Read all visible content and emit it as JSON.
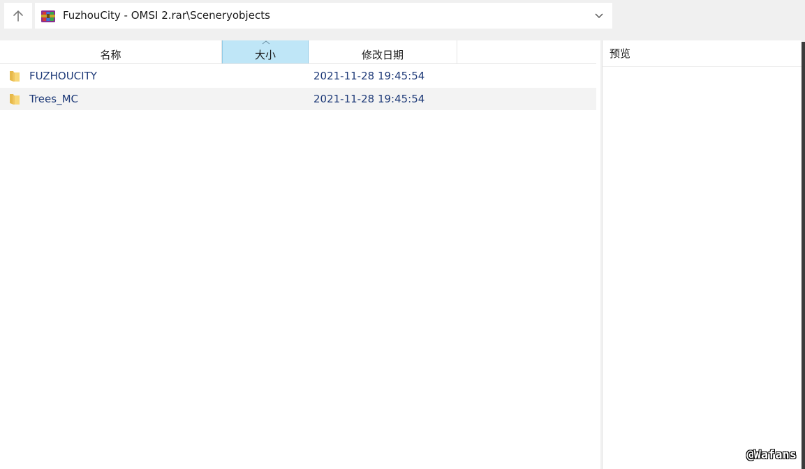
{
  "address_bar": {
    "path": "FuzhouCity - OMSI 2.rar\\Sceneryobjects",
    "up_icon": "arrow-up-icon",
    "archive_icon": "winrar-archive-icon",
    "dropdown_icon": "chevron-down-icon"
  },
  "columns": {
    "name": "名称",
    "size": "大小",
    "date": "修改日期",
    "sorted_column": "size"
  },
  "rows": [
    {
      "name": "FUZHOUCITY",
      "size": "",
      "date": "2021-11-28 19:45:54",
      "icon": "folder-icon"
    },
    {
      "name": "Trees_MC",
      "size": "",
      "date": "2021-11-28 19:45:54",
      "icon": "folder-icon"
    }
  ],
  "preview": {
    "title": "预览"
  },
  "watermark": "@Wafans",
  "colors": {
    "sorted_header_bg": "#bfe6f7",
    "item_text": "#1e3a78",
    "folder": "#f5c75b"
  }
}
